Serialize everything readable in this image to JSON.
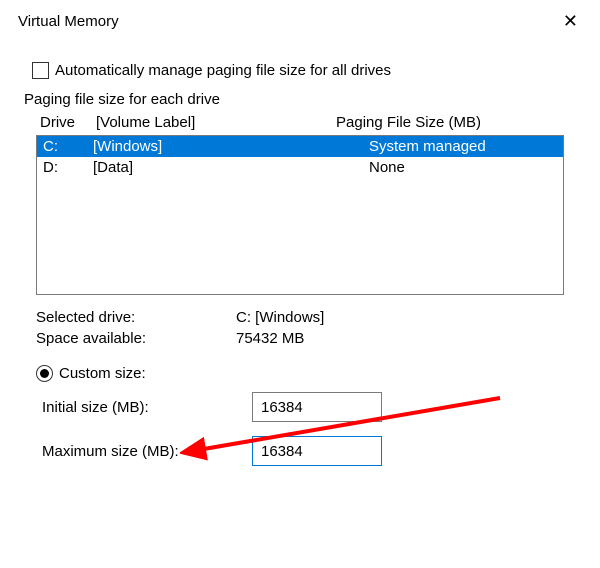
{
  "window": {
    "title": "Virtual Memory",
    "close": "✕"
  },
  "autoManage": {
    "label": "Automatically manage paging file size for all drives",
    "checked": false
  },
  "sectionLabel": "Paging file size for each drive",
  "headers": {
    "drive": "Drive",
    "volumeLabel": "[Volume Label]",
    "pagingSize": "Paging File Size (MB)"
  },
  "drives": [
    {
      "letter": "C:",
      "volume": "[Windows]",
      "paging": "System managed",
      "selected": true
    },
    {
      "letter": "D:",
      "volume": "[Data]",
      "paging": "None",
      "selected": false
    }
  ],
  "selected": {
    "driveLabel": "Selected drive:",
    "driveValue": "C:  [Windows]",
    "spaceLabel": "Space available:",
    "spaceValue": "75432 MB"
  },
  "customSize": {
    "radioLabel": "Custom size:",
    "checked": true,
    "initialLabel": "Initial size (MB):",
    "initialValue": "16384",
    "maxLabel": "Maximum size (MB):",
    "maxValue": "16384"
  },
  "annotation": {
    "arrowColor": "#ff0000"
  }
}
